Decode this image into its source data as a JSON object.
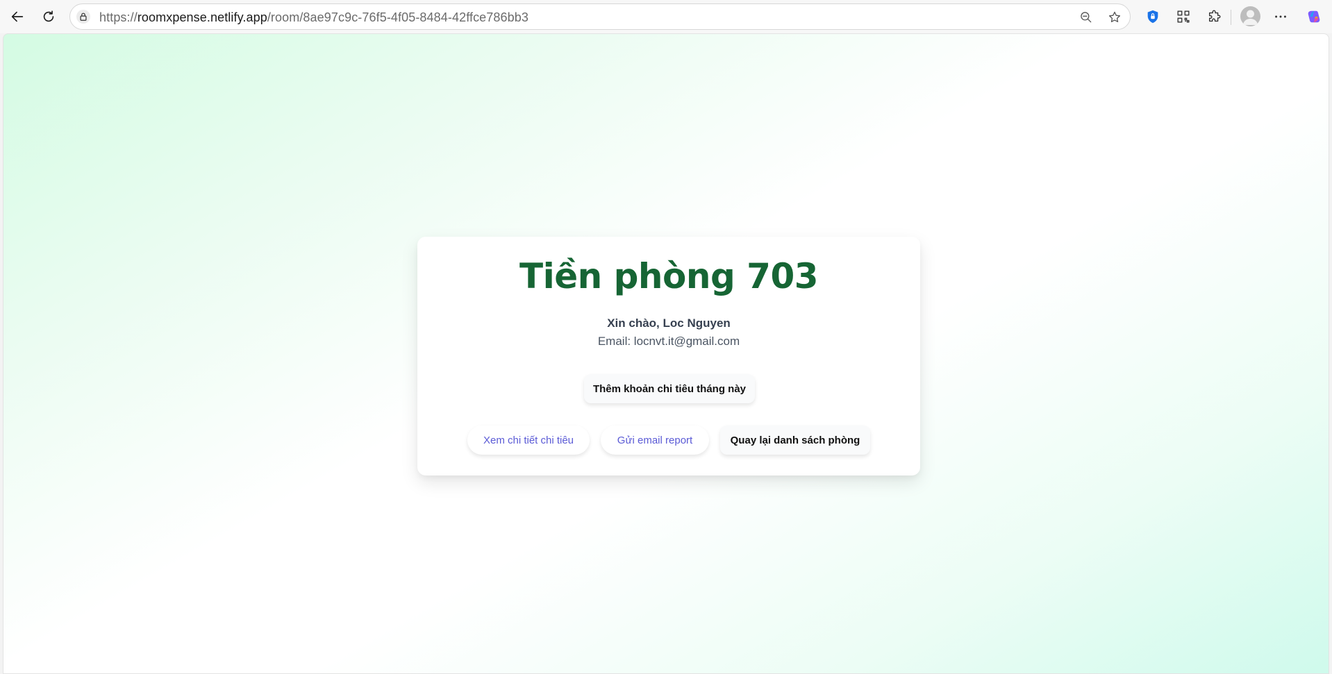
{
  "browser": {
    "url_prefix": "https://",
    "url_host": "roomxpense.netlify.app",
    "url_path": "/room/8ae97c9c-76f5-4f05-8484-42ffce786bb3",
    "icons": [
      "back-icon",
      "reload-icon",
      "lock-icon",
      "zoom-out-icon",
      "star-icon",
      "shield-icon",
      "qr-code-icon",
      "extensions-icon",
      "avatar",
      "more-icon",
      "copilot-icon"
    ]
  },
  "card": {
    "title": "Tiền phòng 703",
    "greeting": "Xin chào, Loc Nguyen",
    "email": "Email: locnvt.it@gmail.com",
    "add_expense_button": "Thêm khoản chi tiêu tháng này",
    "view_details_button": "Xem chi tiết chi tiêu",
    "send_report_button": "Gửi email report",
    "back_to_rooms_button": "Quay lại danh sách phòng"
  },
  "colors": {
    "title": "#166534",
    "link_button": "#5b5bd6",
    "background_gradient_start": "#d4fbe3",
    "background_gradient_end": "#cffaec"
  }
}
